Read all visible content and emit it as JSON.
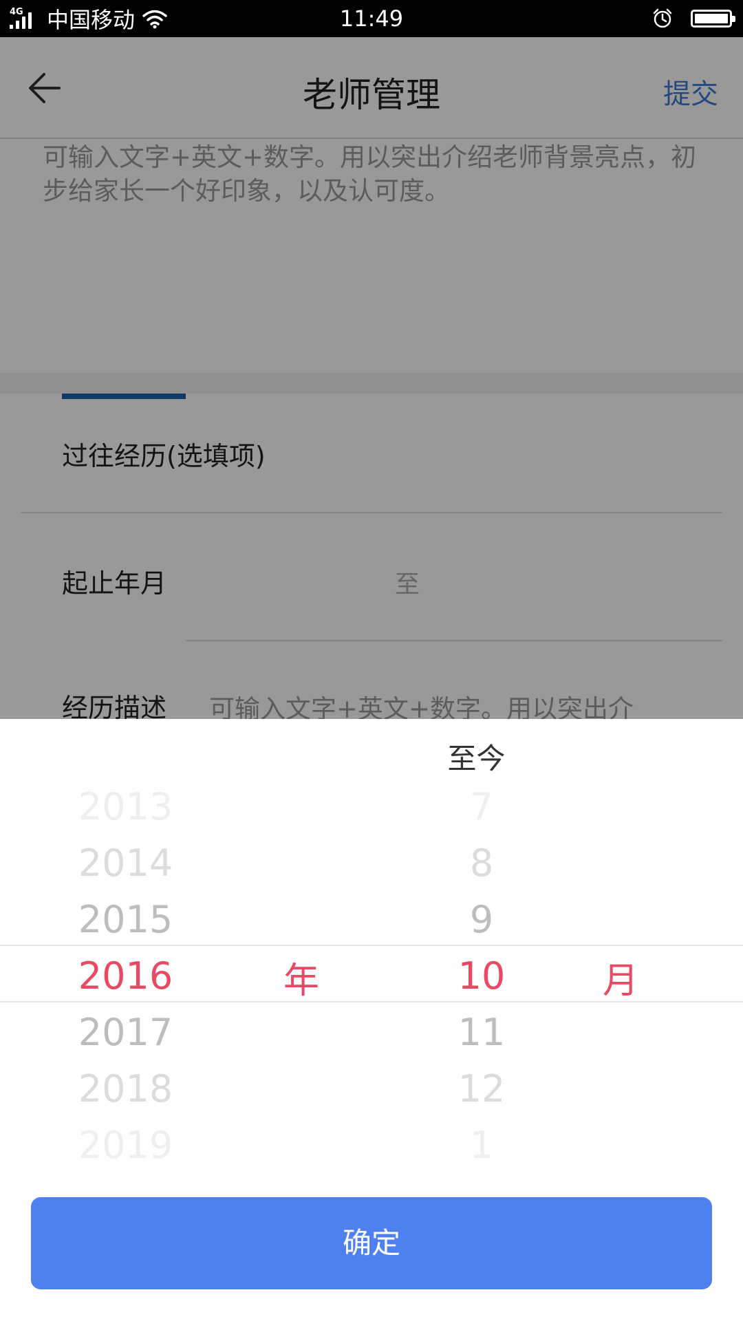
{
  "status_bar": {
    "network": "4G",
    "carrier": "中国移动",
    "time": "11:49",
    "battery_level": 1.0
  },
  "header": {
    "title": "老师管理",
    "submit_label": "提交"
  },
  "form": {
    "intro_text": "可输入文字+英文+数字。用以突出介绍老师背景亮点，初步给家长一个好印象，以及认可度。",
    "experience_title": "过往经历(选填项)",
    "date_label": "起止年月",
    "date_to": "至",
    "desc_label": "经历描述",
    "desc_placeholder": "可输入文字+英文+数字。用以突出介"
  },
  "picker": {
    "until_now_label": "至今",
    "year_unit": "年",
    "month_unit": "月",
    "years": [
      "2013",
      "2014",
      "2015",
      "2016",
      "2017",
      "2018",
      "2019"
    ],
    "months": [
      "7",
      "8",
      "9",
      "10",
      "11",
      "12",
      "1"
    ],
    "selected_year": "2016",
    "selected_month": "10",
    "confirm_label": "确定"
  },
  "colors": {
    "accent": "#4f80f0",
    "selected": "#e84a63",
    "link": "#3a7bd5"
  },
  "icons": [
    "signal-icon",
    "wifi-icon",
    "alarm-icon",
    "battery-icon",
    "back-arrow-icon"
  ]
}
